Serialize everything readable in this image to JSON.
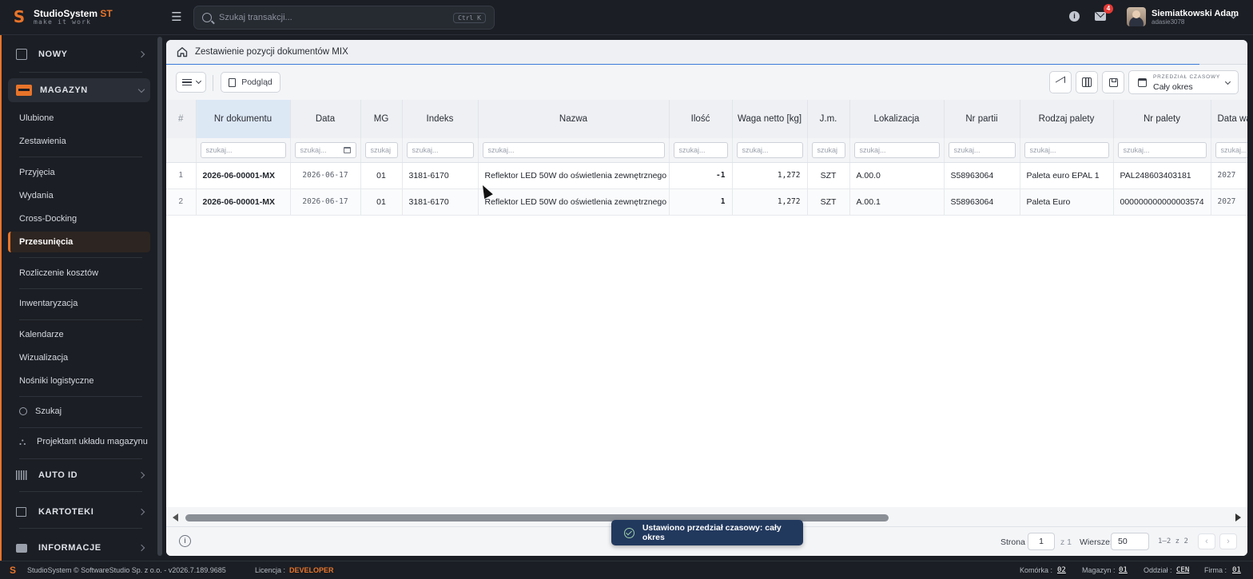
{
  "app": {
    "logo_name": "StudioSystem",
    "logo_suffix": "ST",
    "logo_tagline": "make it work"
  },
  "search": {
    "placeholder": "Szukaj transakcji...",
    "shortcut": "Ctrl K"
  },
  "notifications": {
    "mail_count": "4"
  },
  "user": {
    "name": "Siemiatkowski Adam",
    "login": "adasie3078"
  },
  "sidebar": {
    "nowy": "NOWY",
    "magazyn": "MAGAZYN",
    "items": [
      {
        "label": "Ulubione"
      },
      {
        "label": "Zestawienia"
      },
      {
        "label": "Przyjęcia"
      },
      {
        "label": "Wydania"
      },
      {
        "label": "Cross-Docking"
      },
      {
        "label": "Przesunięcia"
      },
      {
        "label": "Rozliczenie kosztów"
      },
      {
        "label": "Inwentaryzacja"
      },
      {
        "label": "Kalendarze"
      },
      {
        "label": "Wizualizacja"
      },
      {
        "label": "Nośniki logistyczne"
      }
    ],
    "szukaj": "Szukaj",
    "projektant": "Projektant układu magazynu",
    "auto_id": "AUTO ID",
    "kartoteki": "KARTOTEKI",
    "informacje": "INFORMACJE"
  },
  "panel": {
    "title": "Zestawienie pozycji dokumentów MIX",
    "preview_label": "Podgląd",
    "period_label": "PRZEDZIAŁ CZASOWY",
    "period_value": "Cały okres"
  },
  "table": {
    "columns": {
      "hash": "#",
      "doc": "Nr dokumentu",
      "date": "Data",
      "mg": "MG",
      "index": "Indeks",
      "name": "Nazwa",
      "qty": "Ilość",
      "weight": "Waga netto [kg]",
      "unit": "J.m.",
      "location": "Lokalizacja",
      "batch": "Nr partii",
      "pallet_type": "Rodzaj palety",
      "pallet_no": "Nr palety",
      "date_w": "Data wa"
    },
    "filter_placeholder": "szukaj...",
    "filter_placeholder_short": "szukaj",
    "rows": [
      {
        "n": "1",
        "doc": "2026-06-00001-MX",
        "date": "2026-06-17",
        "mg": "01",
        "index": "3181-6170",
        "name": "Reflektor LED 50W do oświetlenia zewnętrznego",
        "qty": "-1",
        "weight": "1,272",
        "unit": "SZT",
        "location": "A.00.0",
        "batch": "S58963064",
        "pallet_type": "Paleta euro EPAL 1",
        "pallet_no": "PAL248603403181",
        "date_w": "2027"
      },
      {
        "n": "2",
        "doc": "2026-06-00001-MX",
        "date": "2026-06-17",
        "mg": "01",
        "index": "3181-6170",
        "name": "Reflektor LED 50W do oświetlenia zewnętrznego",
        "qty": "1",
        "weight": "1,272",
        "unit": "SZT",
        "location": "A.00.1",
        "batch": "S58963064",
        "pallet_type": "Paleta Euro",
        "pallet_no": "000000000000003574",
        "date_w": "2027"
      }
    ]
  },
  "footer": {
    "page_label": "Strona",
    "page_value": "1",
    "page_of": "z 1",
    "rows_label": "Wiersze:",
    "rows_value": "50",
    "range": "1–2 z 2"
  },
  "toast": {
    "message": "Ustawiono przedział czasowy: cały okres"
  },
  "status": {
    "copyright": "StudioSystem © SoftwareStudio Sp. z o.o. - v2026.7.189.9685",
    "license_label": "Licencja :",
    "license_value": "DEVELOPER",
    "cell_label": "Komórka :",
    "cell_value": "02",
    "warehouse_label": "Magazyn :",
    "warehouse_value": "01",
    "branch_label": "Oddział :",
    "branch_value": "CEN",
    "company_label": "Firma :",
    "company_value": "01"
  },
  "colors": {
    "accent": "#e8742a",
    "toast": "#22395e",
    "link_blue": "#3d7bd9"
  }
}
